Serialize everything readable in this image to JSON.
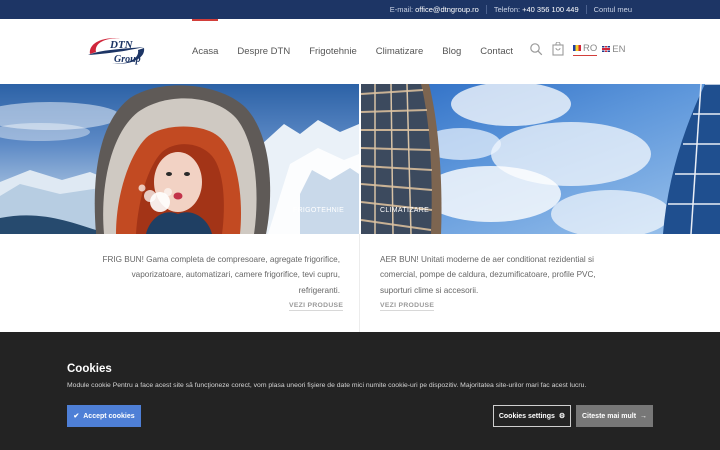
{
  "topbar": {
    "email_label": "E-mail:",
    "email_value": "office@dtngroup.ro",
    "phone_label": "Telefon:",
    "phone_value": "+40 356 100 449",
    "account": "Contul meu"
  },
  "logo": {
    "line1": "DTN",
    "line2": "Group"
  },
  "nav": {
    "items": [
      {
        "label": "Acasa",
        "active": true
      },
      {
        "label": "Despre DTN"
      },
      {
        "label": "Frigotehnie"
      },
      {
        "label": "Climatizare"
      },
      {
        "label": "Blog"
      },
      {
        "label": "Contact"
      }
    ]
  },
  "header_icons": [
    "search-icon",
    "cart-icon"
  ],
  "languages": [
    {
      "code": "RO",
      "active": true
    },
    {
      "code": "EN"
    }
  ],
  "hero": {
    "left_label": "FRIGOTEHNIE",
    "right_label": "CLIMATIZARE"
  },
  "categories": {
    "left": {
      "text": "FRIG BUN! Gama completa de compresoare, agregate frigorifice, vaporizatoare, automatizari, camere frigorifice, tevi cupru, refrigeranti.",
      "link": "VEZI PRODUSE"
    },
    "right": {
      "text": "AER BUN! Unitati moderne de aer conditionat rezidential si comercial, pompe de caldura, dezumificatoare, profile PVC, suporturi clime si accesorii.",
      "link": "VEZI PRODUSE"
    }
  },
  "cookie": {
    "title": "Cookies",
    "text": "Module cookie Pentru a face acest site să funcţioneze corect, vom plasa uneori fişiere de date mici numite cookie-uri pe dispozitiv. Majoritatea site-urilor mari fac acest lucru.",
    "accept": "Accept cookies",
    "settings": "Cookies settings",
    "more": "Citeste mai mult"
  },
  "colors": {
    "topbar": "#1d3565",
    "accent": "#d23e3a",
    "cookie_bg": "#232323",
    "accept_btn": "#4e7fd6"
  }
}
